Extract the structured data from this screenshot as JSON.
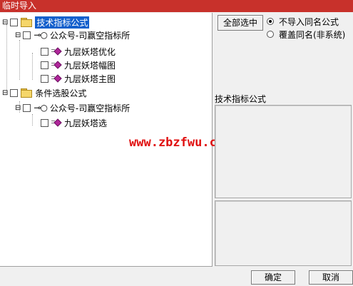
{
  "window": {
    "title": "临时导入"
  },
  "tree": {
    "root1": {
      "label": "技术指标公式"
    },
    "group1": {
      "label": "公众号-司赢空指标所"
    },
    "items1": [
      "九层妖塔优化",
      "九层妖塔幅图",
      "九层妖塔主图"
    ],
    "root2": {
      "label": "条件选股公式"
    },
    "group2": {
      "label": "公众号-司赢空指标所"
    },
    "items2": [
      "九层妖塔选"
    ]
  },
  "actions": {
    "select_all": "全部选中",
    "radio_skip": "不导入同名公式",
    "radio_overwrite": "覆盖同名(非系统)",
    "selected_radio": "radio_skip"
  },
  "details": {
    "label": "技术指标公式"
  },
  "watermark": "www.zbzfwu.com",
  "footer": {
    "ok": "确定",
    "cancel": "取消"
  }
}
